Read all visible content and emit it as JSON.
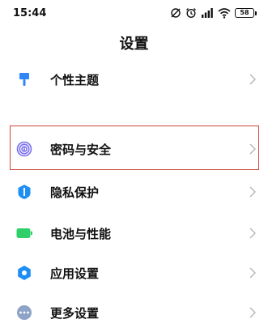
{
  "status_bar": {
    "time": "15:44",
    "battery_level": "58",
    "icons": [
      "dnd-off-icon",
      "alarm-icon",
      "signal-icon",
      "wifi-icon",
      "battery-icon"
    ]
  },
  "header": {
    "title": "设置"
  },
  "settings": [
    {
      "label": "个性主题",
      "icon": "theme-brush-icon",
      "color": "#2f86f6"
    },
    {
      "label": "密码与安全",
      "icon": "fingerprint-icon",
      "color": "#7b6ff0"
    },
    {
      "label": "隐私保护",
      "icon": "privacy-shield-icon",
      "color": "#1e90f3"
    },
    {
      "label": "电池与性能",
      "icon": "battery-performance-icon",
      "color": "#2fcf6a"
    },
    {
      "label": "应用设置",
      "icon": "app-settings-gear-icon",
      "color": "#1e8ef5"
    },
    {
      "label": "更多设置",
      "icon": "more-dots-icon",
      "color": "#8da3c7"
    }
  ],
  "colors": {
    "highlight_border": "#c9453b",
    "chevron": "#b5b5b5"
  }
}
